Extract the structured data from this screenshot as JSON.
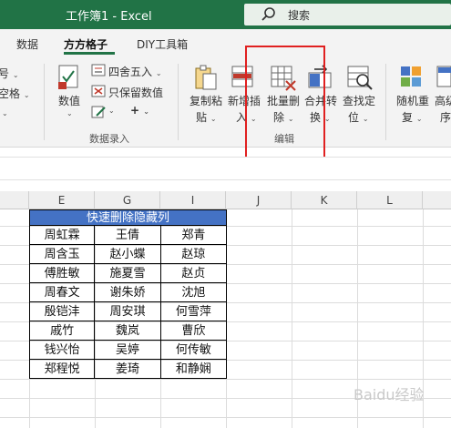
{
  "titlebar": {
    "title": "工作簿1  -  Excel",
    "search_label": "搜索",
    "accent": "#217346"
  },
  "tabs": [
    {
      "label": "数据"
    },
    {
      "label": "方方格子",
      "active": true
    },
    {
      "label": "DIY工具箱"
    }
  ],
  "ribbon": {
    "left_cut_1": "号",
    "left_cut_2": "空格",
    "value_label": "数值",
    "round_label": "四舍五入",
    "keep_value_label": "只保留数值",
    "plus_label": "+",
    "group1_name": "数据录入",
    "copy_paste": [
      "复制粘",
      "贴"
    ],
    "insert": [
      "新增插",
      "入"
    ],
    "batch_delete": [
      "批量删",
      "除"
    ],
    "merge_convert": [
      "合并转",
      "换"
    ],
    "find_locate": [
      "查找定",
      "位"
    ],
    "group2_name": "编辑",
    "random_repeat": [
      "随机重",
      "复"
    ],
    "sort_cut": [
      "高级",
      "序"
    ]
  },
  "columns": [
    "E",
    "G",
    "I",
    "J",
    "K",
    "L"
  ],
  "table": {
    "header": "快速删除隐藏列",
    "header_color": "#4472c4",
    "rows": [
      [
        "周虹霖",
        "王倩",
        "郑青"
      ],
      [
        "周含玉",
        "赵小蝶",
        "赵琼"
      ],
      [
        "傅胜敏",
        "施夏雪",
        "赵贞"
      ],
      [
        "周春文",
        "谢朱娇",
        "沈旭"
      ],
      [
        "殷铠沣",
        "周安琪",
        "何雪萍"
      ],
      [
        "戚竹",
        "魏岚",
        "曹欣"
      ],
      [
        "钱兴怡",
        "吴婷",
        "何传敏"
      ],
      [
        "郑程悦",
        "姜琦",
        "和静娴"
      ]
    ]
  },
  "watermark": "Baidu经验"
}
